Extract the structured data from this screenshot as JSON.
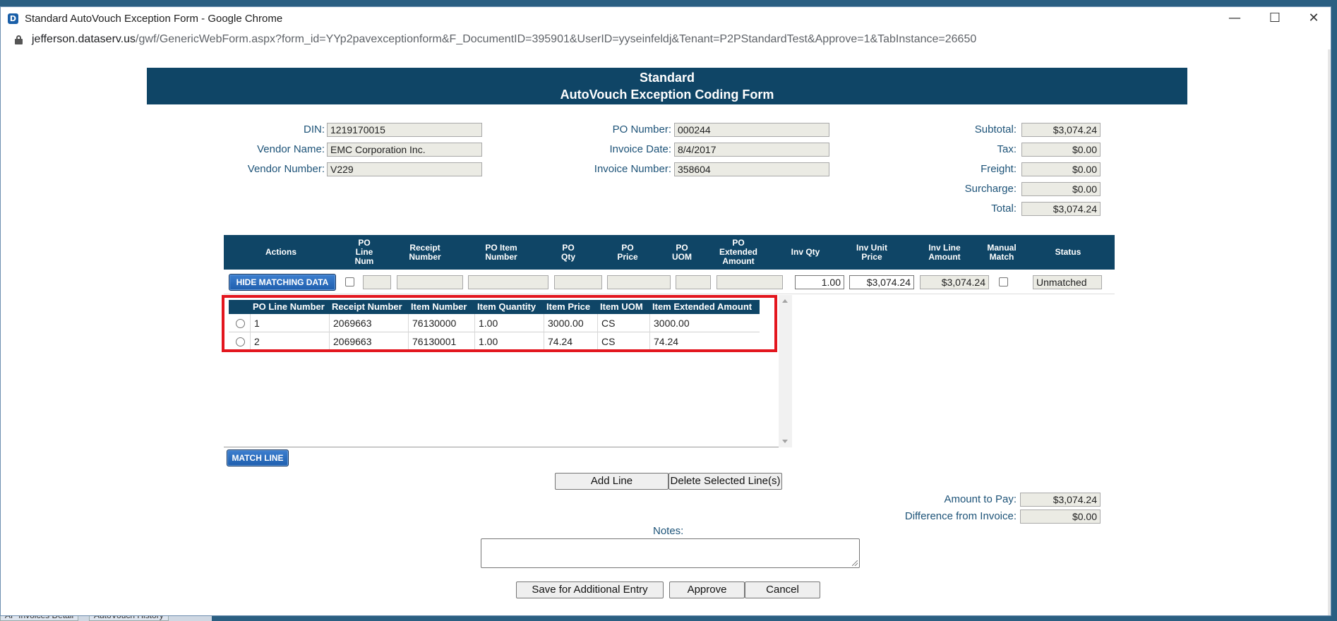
{
  "window": {
    "title": "Standard AutoVouch Exception Form - Google Chrome",
    "url_host": "jefferson.dataserv.us",
    "url_path": "/gwf/GenericWebForm.aspx?form_id=YYp2pavexceptionform&F_DocumentID=395901&UserID=yyseinfeldj&Tenant=P2PStandardTest&Approve=1&TabInstance=26650",
    "minimize_glyph": "—",
    "maximize_glyph": "☐",
    "close_glyph": "✕",
    "app_icon_glyph": "D"
  },
  "background": {
    "tab1": "AP Invoices Detail",
    "tab2": "AutoVouch History"
  },
  "form": {
    "title_line1": "Standard",
    "title_line2": "AutoVouch Exception Coding Form",
    "din_label": "DIN:",
    "din": "1219170015",
    "vendor_name_label": "Vendor Name:",
    "vendor_name": "EMC Corporation Inc.",
    "vendor_number_label": "Vendor Number:",
    "vendor_number": "V229",
    "po_number_label": "PO Number:",
    "po_number": "000244",
    "invoice_date_label": "Invoice Date:",
    "invoice_date": "8/4/2017",
    "invoice_number_label": "Invoice Number:",
    "invoice_number": "358604",
    "subtotal_label": "Subtotal:",
    "subtotal": "$3,074.24",
    "tax_label": "Tax:",
    "tax": "$0.00",
    "freight_label": "Freight:",
    "freight": "$0.00",
    "surcharge_label": "Surcharge:",
    "surcharge": "$0.00",
    "total_label": "Total:",
    "total": "$3,074.24"
  },
  "grid": {
    "headers": {
      "actions": "Actions",
      "po_line_num": "PO Line Num",
      "receipt_number": "Receipt Number",
      "po_item_number": "PO Item Number",
      "po_qty": "PO Qty",
      "po_price": "PO Price",
      "po_uom": "PO UOM",
      "po_extended_amount": "PO Extended Amount",
      "inv_qty": "Inv Qty",
      "inv_unit_price": "Inv Unit Price",
      "inv_line_amount": "Inv Line Amount",
      "manual_match": "Manual Match",
      "status": "Status"
    },
    "row": {
      "hide_button": "HIDE MATCHING DATA",
      "inv_qty": "1.00",
      "inv_unit_price": "$3,074.24",
      "inv_line_amount": "$3,074.24",
      "status": "Unmatched"
    }
  },
  "matching": {
    "headers": [
      "PO Line Number",
      "Receipt Number",
      "Item Number",
      "Item Quantity",
      "Item Price",
      "Item UOM",
      "Item Extended Amount"
    ],
    "rows": [
      [
        "1",
        "2069663",
        "76130000",
        "1.00",
        "3000.00",
        "CS",
        "3000.00"
      ],
      [
        "2",
        "2069663",
        "76130001",
        "1.00",
        "74.24",
        "CS",
        "74.24"
      ]
    ],
    "match_button": "MATCH LINE"
  },
  "actions": {
    "add_line": "Add Line",
    "delete_lines": "Delete Selected Line(s)",
    "save": "Save for Additional Entry",
    "approve": "Approve",
    "cancel": "Cancel"
  },
  "summary": {
    "amount_to_pay_label": "Amount to Pay:",
    "amount_to_pay": "$3,074.24",
    "difference_label": "Difference from Invoice:",
    "difference": "$0.00"
  },
  "notes": {
    "label": "Notes:",
    "value": ""
  }
}
